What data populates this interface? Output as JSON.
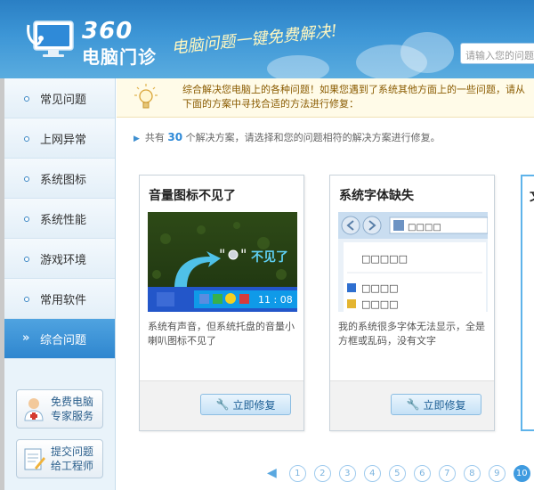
{
  "header": {
    "logo_num": "360",
    "logo_text": "电脑门诊",
    "slogan": "电脑问题一键免费解决!",
    "search_placeholder": "请输入您的问题"
  },
  "sidebar": {
    "items": [
      {
        "label": "常见问题",
        "active": false
      },
      {
        "label": "上网异常",
        "active": false
      },
      {
        "label": "系统图标",
        "active": false
      },
      {
        "label": "系统性能",
        "active": false
      },
      {
        "label": "游戏环境",
        "active": false
      },
      {
        "label": "常用软件",
        "active": false
      },
      {
        "label": "综合问题",
        "active": true
      }
    ],
    "active_arrow": "»",
    "service_button": {
      "line1": "免费电脑",
      "line2": "专家服务"
    },
    "submit_button": {
      "line1": "提交问题",
      "line2": "给工程师"
    }
  },
  "banner": {
    "text": "综合解决您电脑上的各种问题！如果您遇到了系统其他方面上的一些问题，请从下面的方案中寻找合适的方法进行修复："
  },
  "summary": {
    "prefix": "共有",
    "count": "30",
    "suffix": "个解决方案，请选择和您的问题相符的解决方案进行修复。"
  },
  "cards": [
    {
      "title": "音量图标不见了",
      "desc": "系统有声音，但系统托盘的音量小喇叭图标不见了",
      "button": "立即修复",
      "shot_label": "不见了",
      "shot_time": "11 : 08"
    },
    {
      "title": "系统字体缺失",
      "desc": "我的系统很多字体无法显示，全是方框或乱码，没有文字",
      "button": "立即修复",
      "shot_boxes_1": "□□□□",
      "shot_boxes_2": "□□□□□",
      "shot_boxes_3": "□□□□",
      "shot_boxes_4": "□□□□"
    }
  ],
  "card3_partial": {
    "title": "文"
  },
  "pager": {
    "prev": "◀",
    "pages": [
      "1",
      "2",
      "3",
      "4",
      "5",
      "6",
      "7",
      "8",
      "9",
      "10"
    ],
    "active": "10"
  },
  "colors": {
    "header_top": "#2a7fc4",
    "accent": "#3f9be0",
    "banner_text": "#8a5b00",
    "count_blue": "#2f8ad8"
  }
}
